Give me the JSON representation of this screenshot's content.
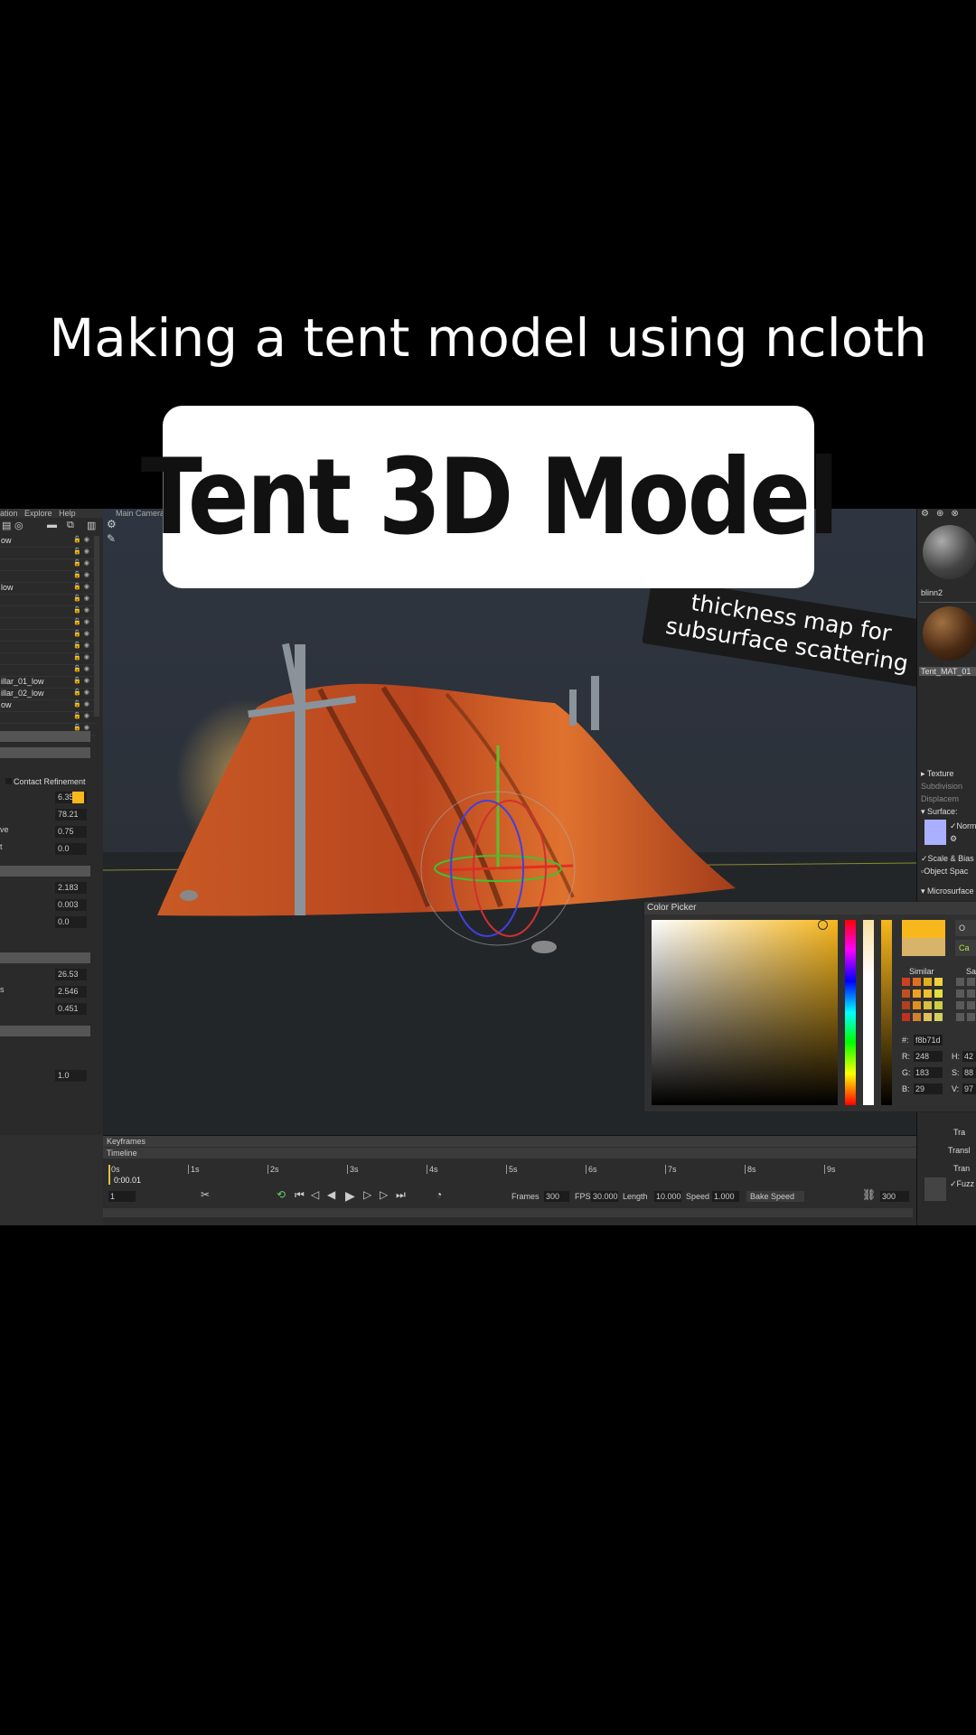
{
  "caption": {
    "text": "Making a tent model using ncloth"
  },
  "title_card": {
    "text": "Tent 3D Model"
  },
  "annotation": {
    "text": "thickness map for subsurface scattering"
  },
  "outliner": {
    "menu": [
      "ation",
      "Explore",
      "Help"
    ],
    "viewport_label": "Main Camera",
    "items": [
      "ow",
      "",
      "",
      "",
      "low",
      "",
      "",
      "",
      "",
      "",
      "",
      "",
      "illar_01_low",
      "illar_02_low",
      "ow",
      "",
      ""
    ],
    "contact_refinement": "Contact Refinement",
    "props_a": [
      {
        "label": "",
        "value": "6.351"
      },
      {
        "label": "",
        "value": "78.21"
      },
      {
        "label": "ve",
        "value": "0.75"
      },
      {
        "label": "t",
        "value": "0.0"
      }
    ],
    "props_b": [
      {
        "label": "",
        "value": "2.183"
      },
      {
        "label": "",
        "value": "0.003"
      },
      {
        "label": "",
        "value": "0.0"
      }
    ],
    "props_c": [
      {
        "label": "",
        "value": "26.53"
      },
      {
        "label": "s",
        "value": "2.546"
      },
      {
        "label": "",
        "value": "0.451"
      }
    ],
    "props_d": [
      {
        "label": "",
        "value": "1.0"
      }
    ]
  },
  "materials": {
    "mat1": "blinn2",
    "mat2": "Tent_MAT_01"
  },
  "rpanel": {
    "texture": "Texture",
    "subdivision": "Subdivision",
    "displacement": "Displacem",
    "surface": "Surface:",
    "normal": "Norm",
    "scale_bias": "Scale & Bias",
    "object_space": "Object Spac",
    "microsurface": "Microsurface",
    "tr": "Tra",
    "transl": "Transl",
    "tran2": "Tran",
    "fuzz": "Fuzz"
  },
  "color_picker": {
    "title": "Color Picker",
    "hex_label": "#:",
    "hex": "f8b71d",
    "similar_label": "Similar",
    "similar2_label": "Sa",
    "r_label": "R:",
    "r": "248",
    "g_label": "G:",
    "g": "183",
    "b_label": "B:",
    "b": "29",
    "h_label": "H:",
    "h": "42",
    "s_label": "S:",
    "s": "88",
    "v_label": "V:",
    "v": "97",
    "btn1": "O",
    "btn2": "Ca",
    "accent": "#f8b71d"
  },
  "timeline": {
    "keyframes_label": "Keyframes",
    "timeline_label": "Timeline",
    "ticks": [
      "0s",
      "1s",
      "2s",
      "3s",
      "4s",
      "5s",
      "6s",
      "7s",
      "8s",
      "9s"
    ],
    "current_time": "0:00.01",
    "frame": "1",
    "frames_label": "Frames",
    "frames": "300",
    "fps_label": "FPS",
    "fps": "30.000",
    "length_label": "Length",
    "length": "10.000",
    "speed_label": "Speed",
    "speed": "1.000",
    "bake_speed": "Bake Speed",
    "end_frame": "300"
  }
}
